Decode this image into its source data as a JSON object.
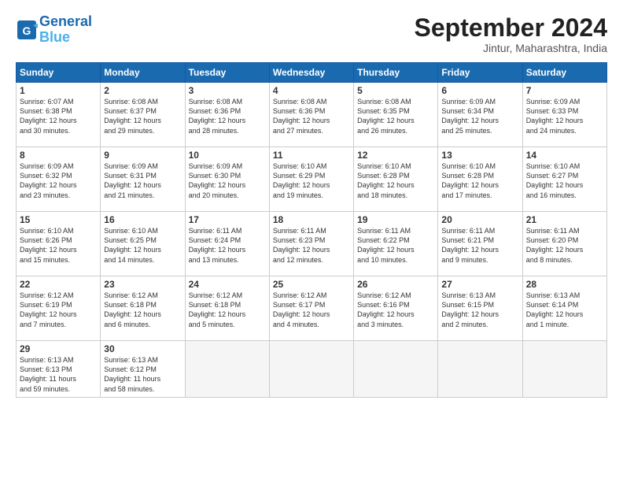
{
  "header": {
    "logo_line1": "General",
    "logo_line2": "Blue",
    "month": "September 2024",
    "location": "Jintur, Maharashtra, India"
  },
  "days_of_week": [
    "Sunday",
    "Monday",
    "Tuesday",
    "Wednesday",
    "Thursday",
    "Friday",
    "Saturday"
  ],
  "weeks": [
    [
      {
        "day": 1,
        "info": "Sunrise: 6:07 AM\nSunset: 6:38 PM\nDaylight: 12 hours\nand 30 minutes."
      },
      {
        "day": 2,
        "info": "Sunrise: 6:08 AM\nSunset: 6:37 PM\nDaylight: 12 hours\nand 29 minutes."
      },
      {
        "day": 3,
        "info": "Sunrise: 6:08 AM\nSunset: 6:36 PM\nDaylight: 12 hours\nand 28 minutes."
      },
      {
        "day": 4,
        "info": "Sunrise: 6:08 AM\nSunset: 6:36 PM\nDaylight: 12 hours\nand 27 minutes."
      },
      {
        "day": 5,
        "info": "Sunrise: 6:08 AM\nSunset: 6:35 PM\nDaylight: 12 hours\nand 26 minutes."
      },
      {
        "day": 6,
        "info": "Sunrise: 6:09 AM\nSunset: 6:34 PM\nDaylight: 12 hours\nand 25 minutes."
      },
      {
        "day": 7,
        "info": "Sunrise: 6:09 AM\nSunset: 6:33 PM\nDaylight: 12 hours\nand 24 minutes."
      }
    ],
    [
      {
        "day": 8,
        "info": "Sunrise: 6:09 AM\nSunset: 6:32 PM\nDaylight: 12 hours\nand 23 minutes."
      },
      {
        "day": 9,
        "info": "Sunrise: 6:09 AM\nSunset: 6:31 PM\nDaylight: 12 hours\nand 21 minutes."
      },
      {
        "day": 10,
        "info": "Sunrise: 6:09 AM\nSunset: 6:30 PM\nDaylight: 12 hours\nand 20 minutes."
      },
      {
        "day": 11,
        "info": "Sunrise: 6:10 AM\nSunset: 6:29 PM\nDaylight: 12 hours\nand 19 minutes."
      },
      {
        "day": 12,
        "info": "Sunrise: 6:10 AM\nSunset: 6:28 PM\nDaylight: 12 hours\nand 18 minutes."
      },
      {
        "day": 13,
        "info": "Sunrise: 6:10 AM\nSunset: 6:28 PM\nDaylight: 12 hours\nand 17 minutes."
      },
      {
        "day": 14,
        "info": "Sunrise: 6:10 AM\nSunset: 6:27 PM\nDaylight: 12 hours\nand 16 minutes."
      }
    ],
    [
      {
        "day": 15,
        "info": "Sunrise: 6:10 AM\nSunset: 6:26 PM\nDaylight: 12 hours\nand 15 minutes."
      },
      {
        "day": 16,
        "info": "Sunrise: 6:10 AM\nSunset: 6:25 PM\nDaylight: 12 hours\nand 14 minutes."
      },
      {
        "day": 17,
        "info": "Sunrise: 6:11 AM\nSunset: 6:24 PM\nDaylight: 12 hours\nand 13 minutes."
      },
      {
        "day": 18,
        "info": "Sunrise: 6:11 AM\nSunset: 6:23 PM\nDaylight: 12 hours\nand 12 minutes."
      },
      {
        "day": 19,
        "info": "Sunrise: 6:11 AM\nSunset: 6:22 PM\nDaylight: 12 hours\nand 10 minutes."
      },
      {
        "day": 20,
        "info": "Sunrise: 6:11 AM\nSunset: 6:21 PM\nDaylight: 12 hours\nand 9 minutes."
      },
      {
        "day": 21,
        "info": "Sunrise: 6:11 AM\nSunset: 6:20 PM\nDaylight: 12 hours\nand 8 minutes."
      }
    ],
    [
      {
        "day": 22,
        "info": "Sunrise: 6:12 AM\nSunset: 6:19 PM\nDaylight: 12 hours\nand 7 minutes."
      },
      {
        "day": 23,
        "info": "Sunrise: 6:12 AM\nSunset: 6:18 PM\nDaylight: 12 hours\nand 6 minutes."
      },
      {
        "day": 24,
        "info": "Sunrise: 6:12 AM\nSunset: 6:18 PM\nDaylight: 12 hours\nand 5 minutes."
      },
      {
        "day": 25,
        "info": "Sunrise: 6:12 AM\nSunset: 6:17 PM\nDaylight: 12 hours\nand 4 minutes."
      },
      {
        "day": 26,
        "info": "Sunrise: 6:12 AM\nSunset: 6:16 PM\nDaylight: 12 hours\nand 3 minutes."
      },
      {
        "day": 27,
        "info": "Sunrise: 6:13 AM\nSunset: 6:15 PM\nDaylight: 12 hours\nand 2 minutes."
      },
      {
        "day": 28,
        "info": "Sunrise: 6:13 AM\nSunset: 6:14 PM\nDaylight: 12 hours\nand 1 minute."
      }
    ],
    [
      {
        "day": 29,
        "info": "Sunrise: 6:13 AM\nSunset: 6:13 PM\nDaylight: 11 hours\nand 59 minutes."
      },
      {
        "day": 30,
        "info": "Sunrise: 6:13 AM\nSunset: 6:12 PM\nDaylight: 11 hours\nand 58 minutes."
      },
      {
        "day": null,
        "info": ""
      },
      {
        "day": null,
        "info": ""
      },
      {
        "day": null,
        "info": ""
      },
      {
        "day": null,
        "info": ""
      },
      {
        "day": null,
        "info": ""
      }
    ]
  ]
}
